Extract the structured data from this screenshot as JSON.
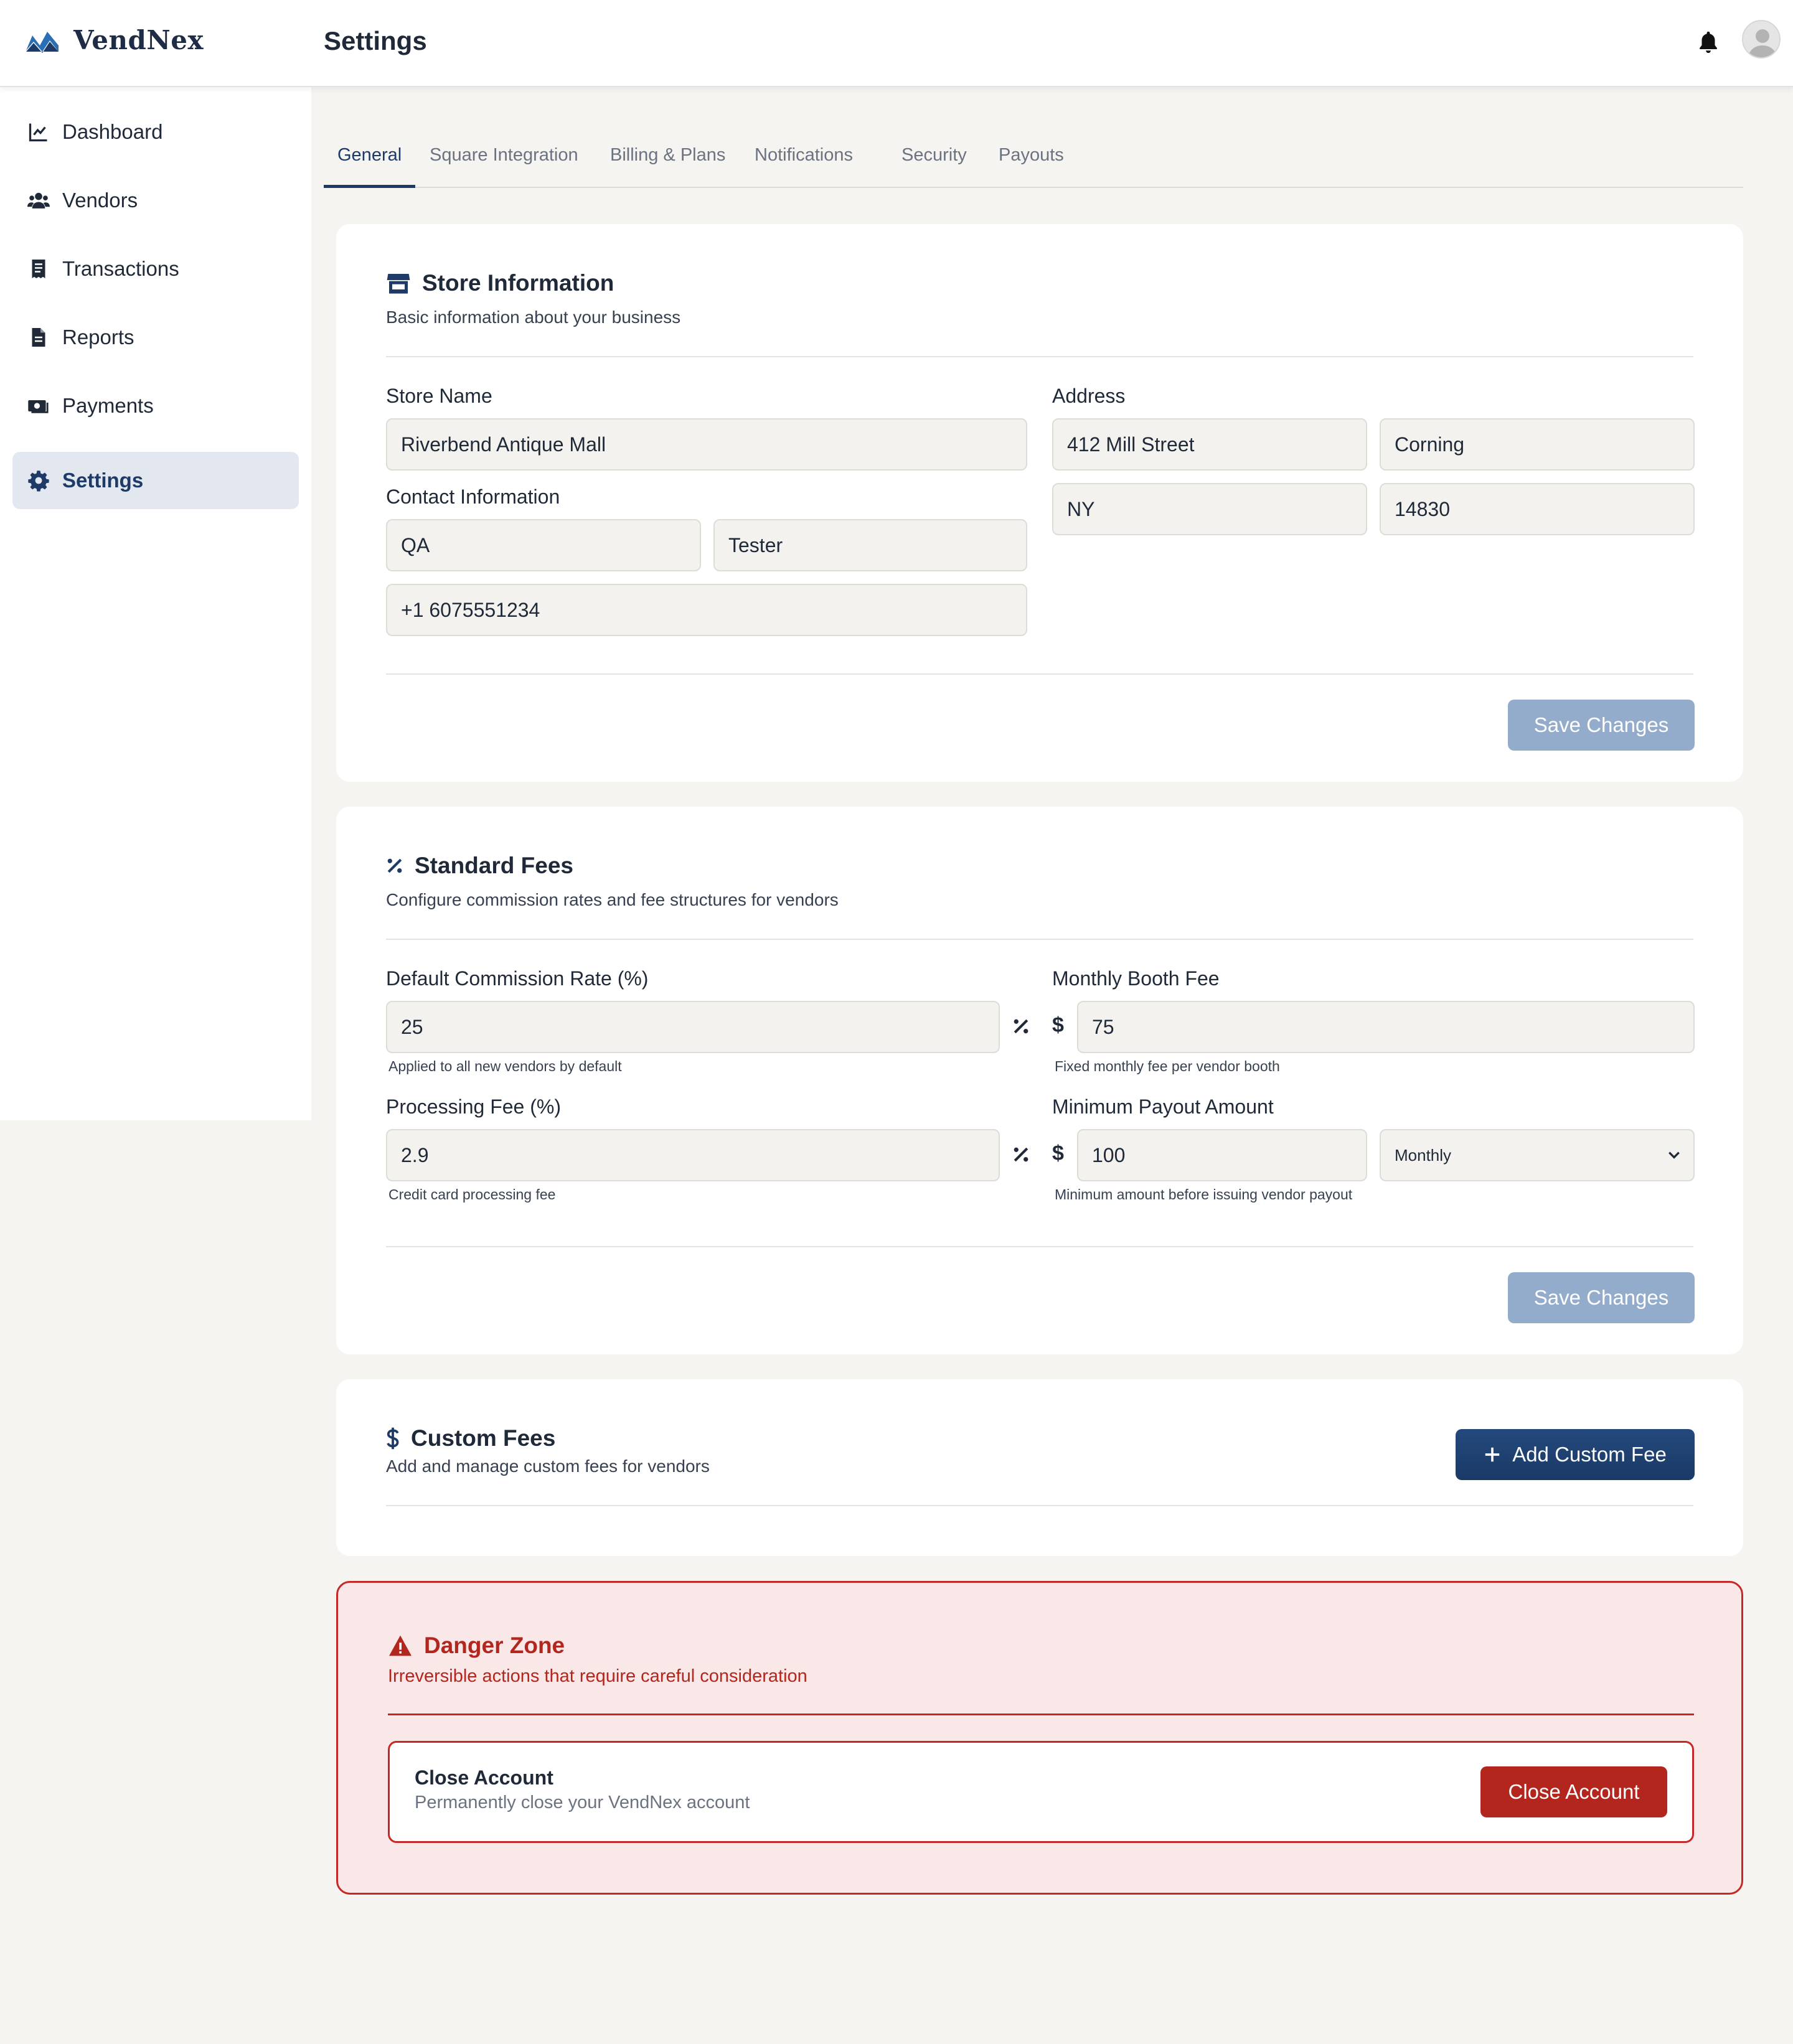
{
  "app": {
    "name": "VendNex",
    "page_title": "Settings"
  },
  "icons": {
    "logo": "vendnex-logo",
    "bell": "bell-icon",
    "avatar": "user-avatar-icon"
  },
  "sidebar": {
    "items": [
      {
        "label": "Dashboard",
        "icon": "chart-line-icon"
      },
      {
        "label": "Vendors",
        "icon": "users-icon"
      },
      {
        "label": "Transactions",
        "icon": "receipt-icon"
      },
      {
        "label": "Reports",
        "icon": "file-icon"
      },
      {
        "label": "Payments",
        "icon": "money-icon"
      },
      {
        "label": "Settings",
        "icon": "gear-icon",
        "active": true
      }
    ]
  },
  "tabs": [
    {
      "label": "General",
      "active": true
    },
    {
      "label": "Square Integration"
    },
    {
      "label": "Billing & Plans"
    },
    {
      "label": "Notifications"
    },
    {
      "label": "Security"
    },
    {
      "label": "Payouts"
    }
  ],
  "store_info": {
    "title": "Store Information",
    "subtitle": "Basic information about your business",
    "store_name_label": "Store Name",
    "store_name": "Riverbend Antique Mall",
    "contact_label": "Contact Information",
    "first_name": "QA",
    "last_name": "Tester",
    "phone": "+1 6075551234",
    "address_label": "Address",
    "street": "412 Mill Street",
    "city": "Corning",
    "state": "NY",
    "zip": "14830",
    "save_label": "Save Changes"
  },
  "standard_fees": {
    "title": "Standard Fees",
    "subtitle": "Configure commission rates and fee structures for vendors",
    "commission_label": "Default Commission Rate (%)",
    "commission_value": "25",
    "commission_hint": "Applied to all new vendors by default",
    "booth_label": "Monthly Booth Fee",
    "booth_value": "75",
    "booth_hint": "Fixed monthly fee per vendor booth",
    "processing_label": "Processing Fee (%)",
    "processing_value": "2.9",
    "processing_hint": "Credit card processing fee",
    "payout_label": "Minimum Payout Amount",
    "payout_value": "100",
    "payout_frequency": "Monthly",
    "payout_hint": "Minimum amount before issuing vendor payout",
    "currency_symbol": "$",
    "save_label": "Save Changes"
  },
  "custom_fees": {
    "title": "Custom Fees",
    "subtitle": "Add and manage custom fees for vendors",
    "add_label": "Add Custom Fee"
  },
  "danger_zone": {
    "title": "Danger Zone",
    "subtitle": "Irreversible actions that require careful consideration",
    "close_title": "Close Account",
    "close_sub": "Permanently close your VendNex account",
    "close_button": "Close Account"
  },
  "colors": {
    "brand": "#1e3a66",
    "accent": "#2a6fb5",
    "danger": "#b3261e",
    "save_disabled": "#94accb"
  }
}
